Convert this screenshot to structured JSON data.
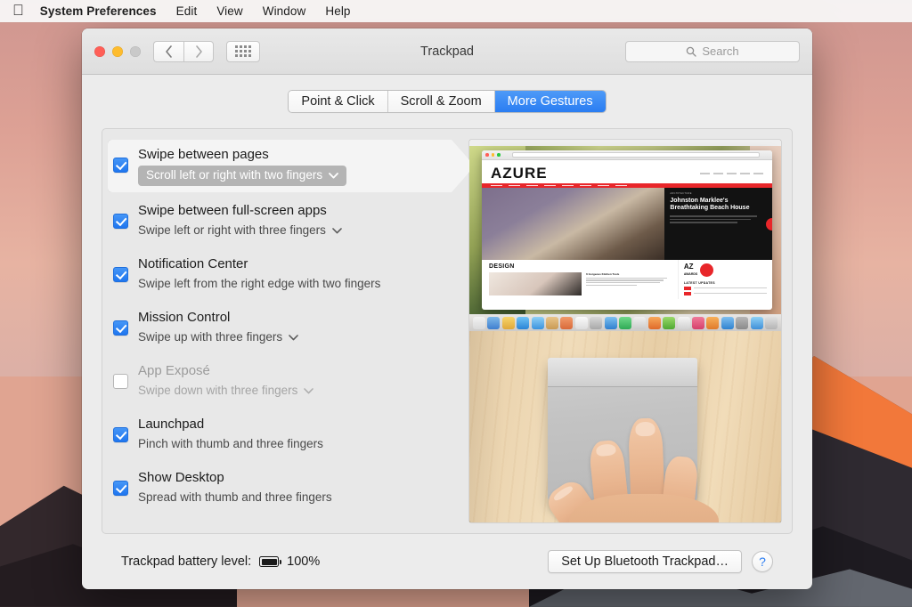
{
  "menubar": {
    "apple_glyph": "apple-logo",
    "items": [
      {
        "label": "System Preferences",
        "bold": true
      },
      {
        "label": "Edit",
        "bold": false
      },
      {
        "label": "View",
        "bold": false
      },
      {
        "label": "Window",
        "bold": false
      },
      {
        "label": "Help",
        "bold": false
      }
    ]
  },
  "window": {
    "title": "Trackpad",
    "traffic_lights": [
      "close",
      "minimize",
      "zoom-disabled"
    ],
    "nav": {
      "back": "back-chevron",
      "forward": "forward-chevron",
      "show_all": "grid-dots"
    },
    "search": {
      "placeholder": "Search",
      "value": "",
      "icon": "search-icon"
    }
  },
  "tabs": [
    {
      "label": "Point & Click",
      "active": false
    },
    {
      "label": "Scroll & Zoom",
      "active": false
    },
    {
      "label": "More Gestures",
      "active": true
    }
  ],
  "gestures": [
    {
      "title": "Swipe between pages",
      "subtitle": "Scroll left or right with two fingers",
      "checked": true,
      "enabled": true,
      "has_popup": true,
      "selected": true,
      "popup_active": true
    },
    {
      "title": "Swipe between full-screen apps",
      "subtitle": "Swipe left or right with three fingers",
      "checked": true,
      "enabled": true,
      "has_popup": true,
      "selected": false,
      "popup_active": false
    },
    {
      "title": "Notification Center",
      "subtitle": "Swipe left from the right edge with two fingers",
      "checked": true,
      "enabled": true,
      "has_popup": false,
      "selected": false,
      "popup_active": false
    },
    {
      "title": "Mission Control",
      "subtitle": "Swipe up with three fingers",
      "checked": true,
      "enabled": true,
      "has_popup": true,
      "selected": false,
      "popup_active": false
    },
    {
      "title": "App Exposé",
      "subtitle": "Swipe down with three fingers",
      "checked": false,
      "enabled": false,
      "has_popup": true,
      "selected": false,
      "popup_active": false
    },
    {
      "title": "Launchpad",
      "subtitle": "Pinch with thumb and three fingers",
      "checked": true,
      "enabled": true,
      "has_popup": false,
      "selected": false,
      "popup_active": false
    },
    {
      "title": "Show Desktop",
      "subtitle": "Spread with thumb and three fingers",
      "checked": true,
      "enabled": true,
      "has_popup": false,
      "selected": false,
      "popup_active": false
    }
  ],
  "preview": {
    "screenshot": {
      "site_logo": "AZURE",
      "hero_kicker": "ARCHITECTURE",
      "hero_title": "Johnston Marklee's Breathtaking Beach House",
      "section_heading": "DESIGN",
      "article_title": "6 Gorgeous Kitchen Tools",
      "awards_logo": "AZ",
      "awards_sub": "AWARDS",
      "latest_heading": "LATEST UPDATES"
    },
    "video": {
      "description": "hand-two-fingers-on-trackpad"
    }
  },
  "bottom": {
    "battery_label": "Trackpad battery level:",
    "battery_value": "100%",
    "battery_icon": "battery-full-icon",
    "setup_button": "Set Up Bluetooth Trackpad…",
    "help_button": "?"
  },
  "colors": {
    "accent_blue": "#2a7df2",
    "checkbox_blue": "#2f7ef5",
    "popup_active_gray": "#b4b4b4",
    "window_bg": "#ececec",
    "panel_bg": "#e8e8e8",
    "azure_red": "#e8262a"
  }
}
